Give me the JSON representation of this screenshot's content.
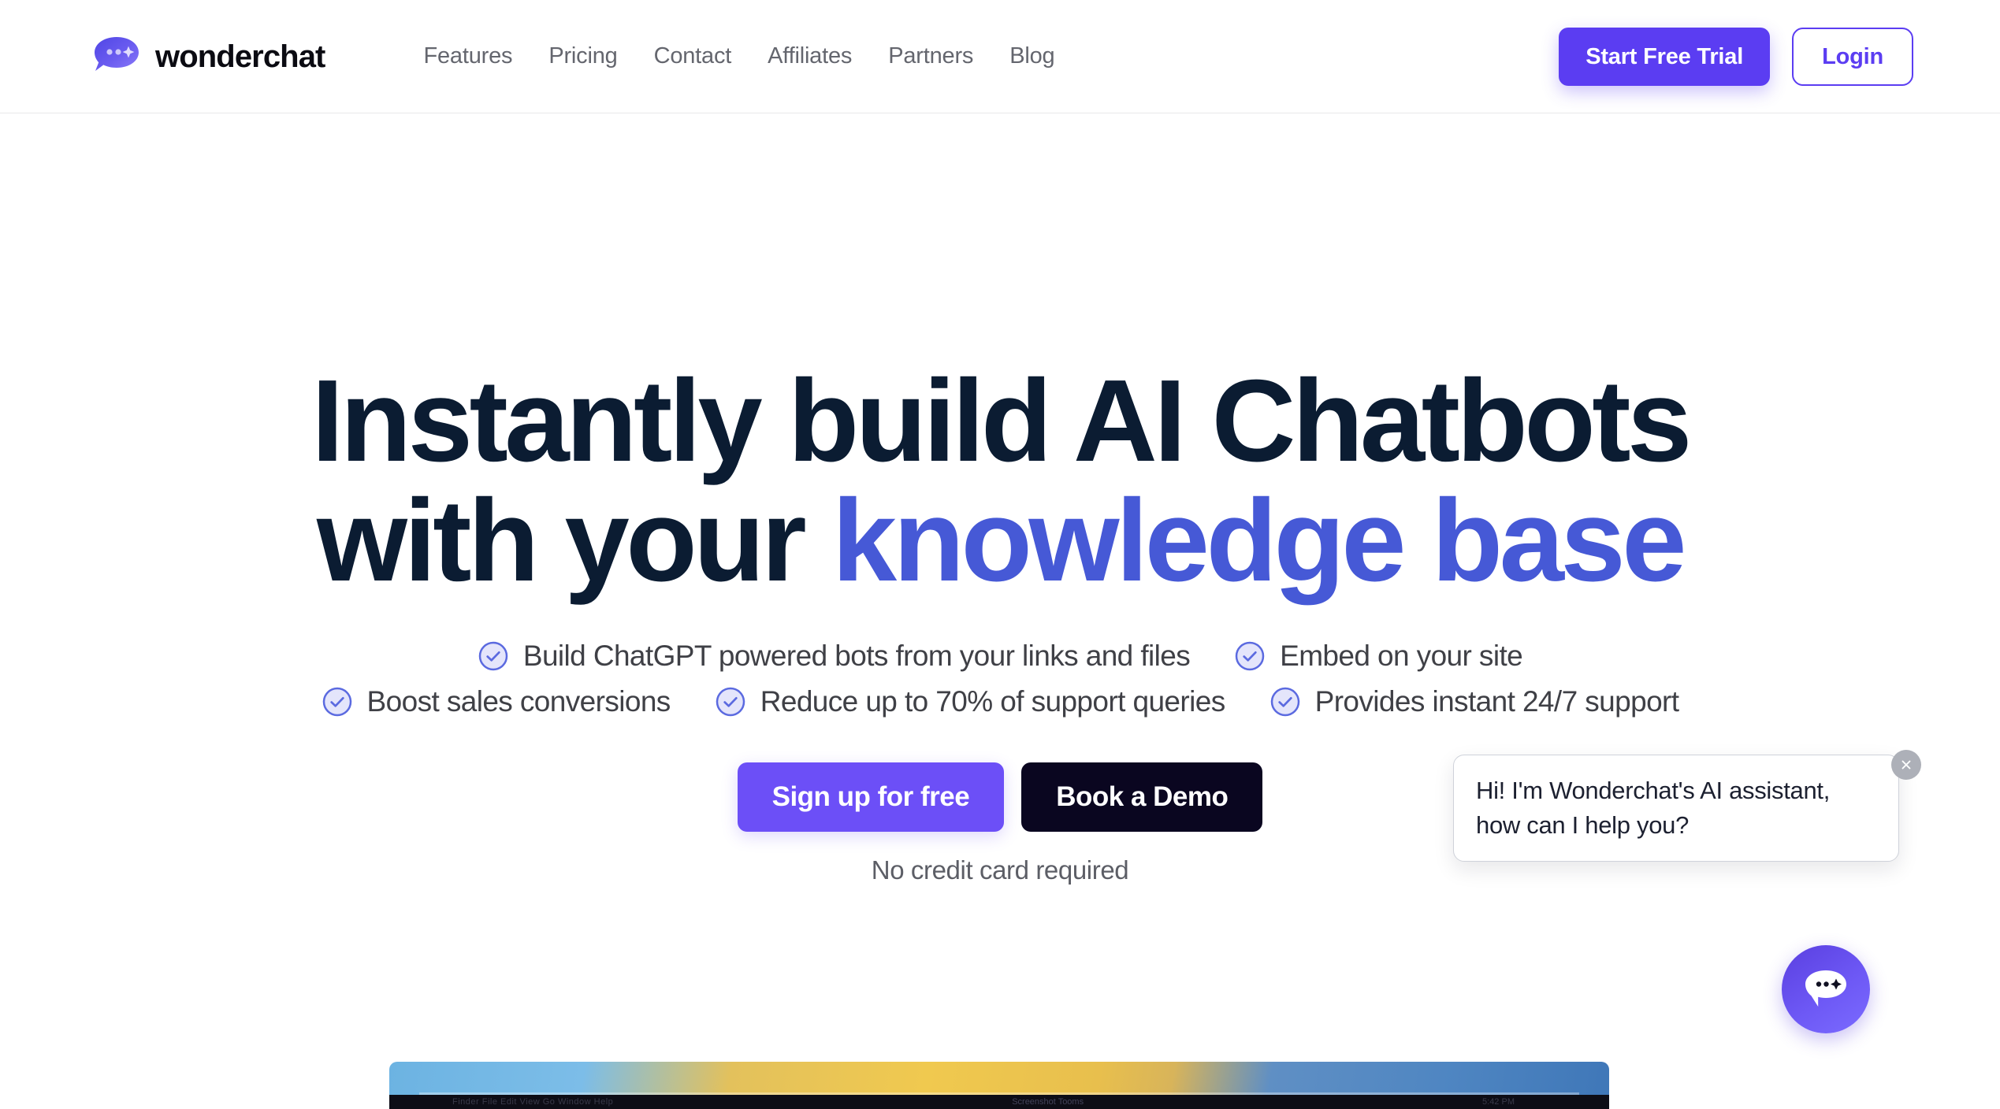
{
  "header": {
    "brand_name": "wonderchat",
    "logo_icon": "chat-bubble-sparkle-icon",
    "nav": [
      {
        "label": "Features"
      },
      {
        "label": "Pricing"
      },
      {
        "label": "Contact"
      },
      {
        "label": "Affiliates"
      },
      {
        "label": "Partners"
      },
      {
        "label": "Blog"
      }
    ],
    "trial_button": "Start Free Trial",
    "login_button": "Login"
  },
  "hero": {
    "headline_line1": "Instantly build AI Chatbots",
    "headline_line2_plain": "with your ",
    "headline_line2_accent": "knowledge base",
    "bullets_row1": [
      {
        "icon": "check-circle-icon",
        "label": "Build ChatGPT powered bots from your links and files"
      },
      {
        "icon": "check-circle-icon",
        "label": "Embed on your site"
      }
    ],
    "bullets_row2": [
      {
        "icon": "check-circle-icon",
        "label": "Boost sales conversions"
      },
      {
        "icon": "check-circle-icon",
        "label": "Reduce up to 70% of support queries"
      },
      {
        "icon": "check-circle-icon",
        "label": "Provides instant 24/7 support"
      }
    ],
    "primary_cta": "Sign up for free",
    "secondary_cta": "Book a Demo",
    "note": "No credit card required"
  },
  "mockup": {
    "menubar_left": "Finder  File  Edit  View  Go  Window  Help",
    "menubar_center": "Screenshot Tooms",
    "menubar_right": "5:42 PM"
  },
  "chat_widget": {
    "greeting": "Hi! I'm Wonderchat's AI assistant, how can I help you?",
    "close_icon": "close-icon",
    "fab_icon": "chat-bubble-sparkle-icon"
  },
  "colors": {
    "brand_purple": "#5b3df2",
    "cta_purple": "#6c4ff7",
    "accent_blue": "#4659d6",
    "headline_navy": "#0b1c32",
    "demo_dark": "#0a0620",
    "nav_gray": "#64666e",
    "check_indigo": "#5b6ae0"
  }
}
